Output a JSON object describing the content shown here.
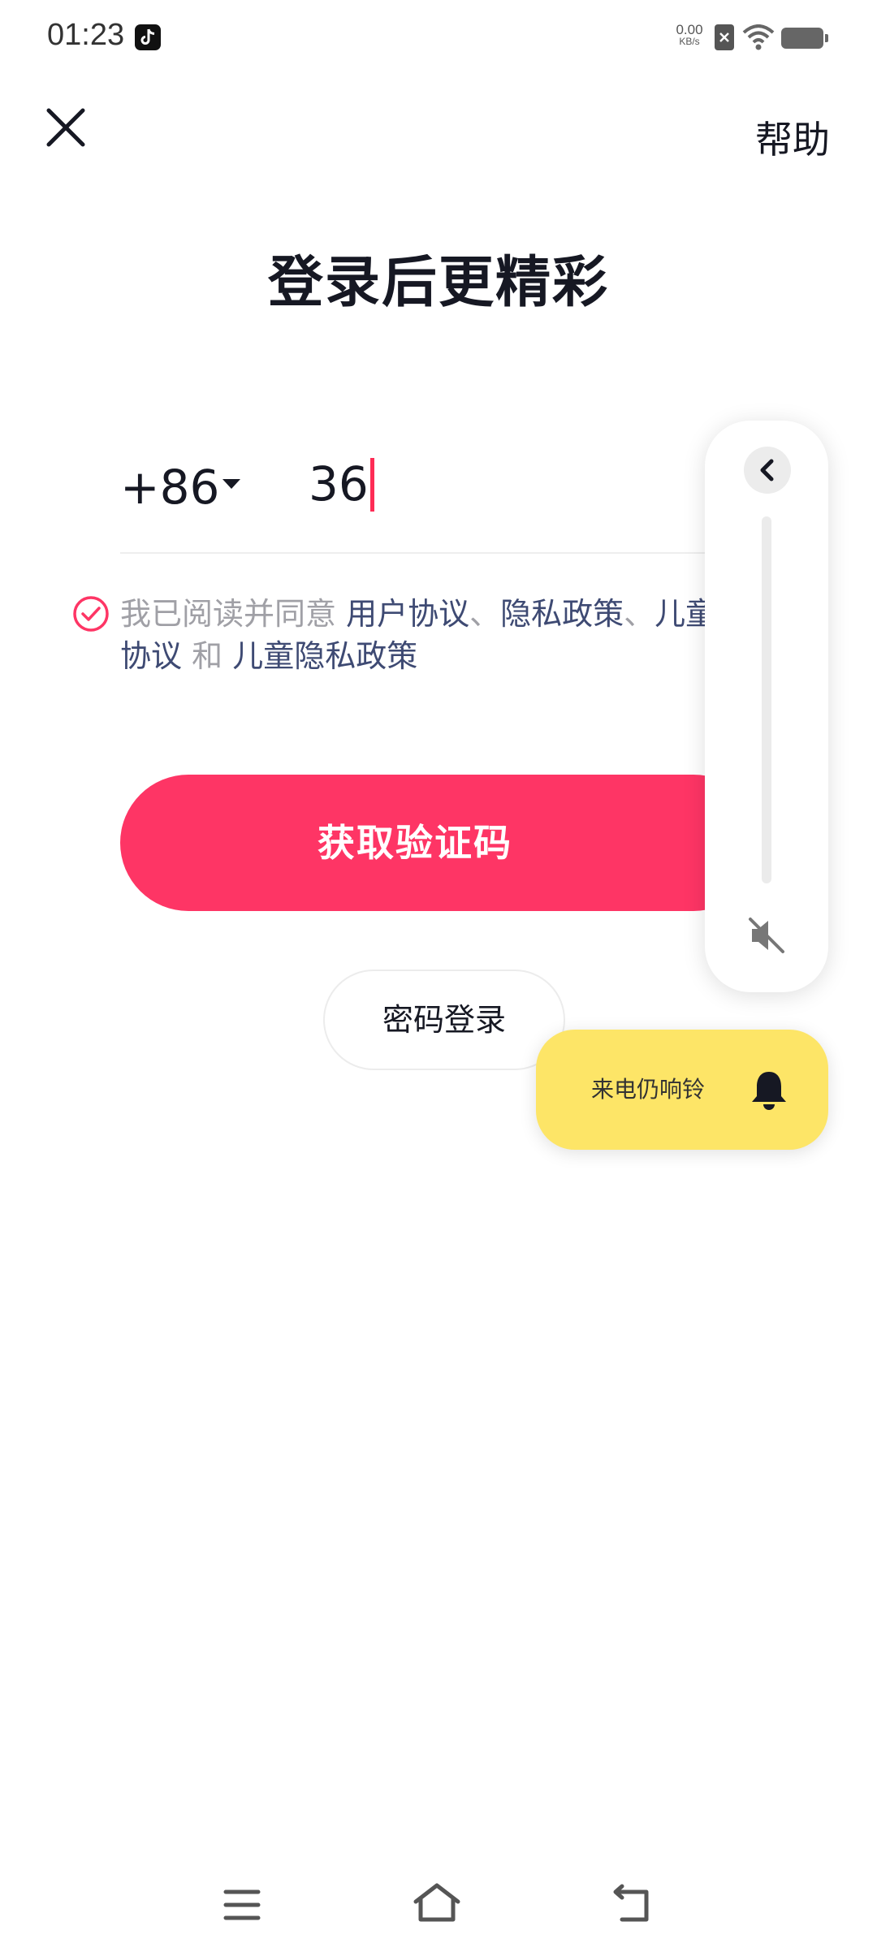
{
  "status_bar": {
    "time": "01:23",
    "net_speed_value": "0.00",
    "net_speed_unit": "KB/s",
    "icons": [
      "tiktok-icon",
      "sim-error-icon",
      "wifi-icon",
      "battery-icon"
    ]
  },
  "header": {
    "close_icon": "close-icon",
    "help_label": "帮助"
  },
  "main": {
    "title": "登录后更精彩",
    "country_code": "+86",
    "phone_value": "36",
    "agreement": {
      "checked": true,
      "prefix": "我已阅读并同意 ",
      "user_agreement": "用户协议",
      "sep1": "、",
      "privacy_policy": "隐私政策",
      "sep2": "、",
      "children_agreement": "儿童协议",
      "and": " 和 ",
      "children_privacy": "儿童隐私政策"
    },
    "primary_button": "获取验证码",
    "password_login": "密码登录"
  },
  "volume_overlay": {
    "level": 0,
    "muted": true,
    "ring_notice": "来电仍响铃"
  },
  "colors": {
    "accent": "#fe3565",
    "link": "#3e4a73",
    "toast": "#fde567"
  },
  "nav_bar": {
    "icons": [
      "menu-icon",
      "home-icon",
      "back-icon"
    ]
  }
}
